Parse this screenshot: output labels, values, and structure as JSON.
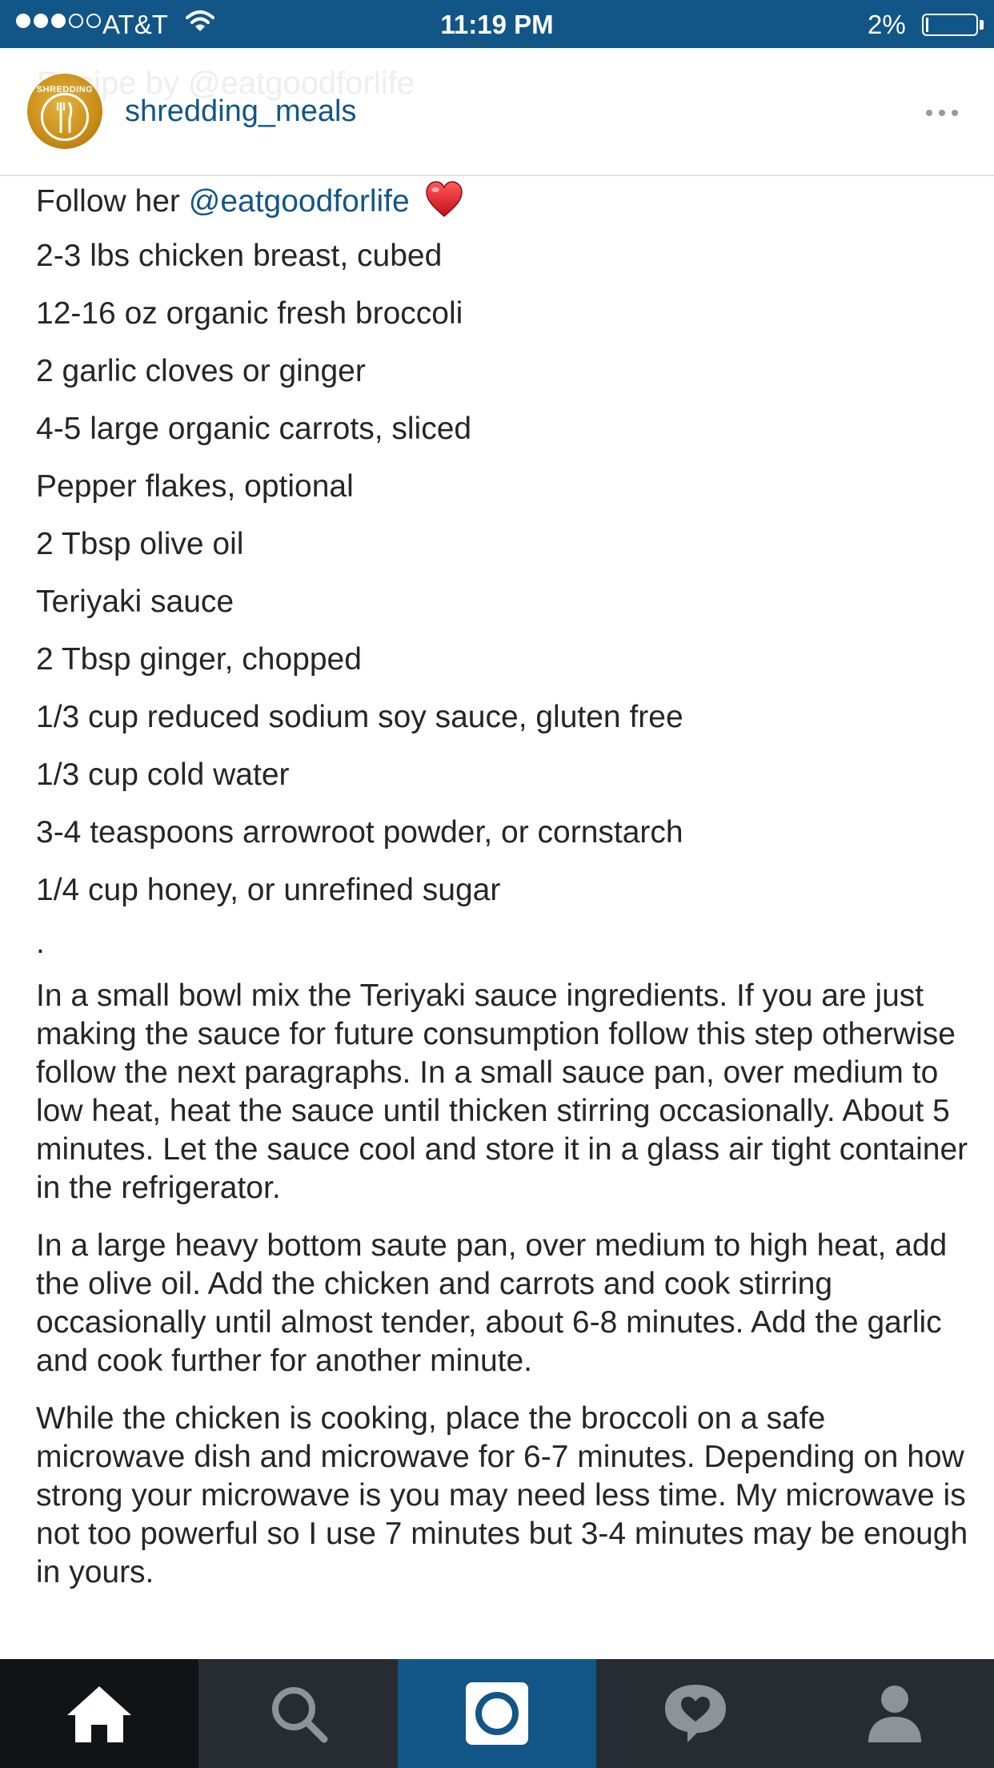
{
  "status_bar": {
    "carrier": "AT&T",
    "time": "11:19 PM",
    "battery_percent": "2%",
    "signal_bars_filled": 3,
    "signal_bars_total": 5,
    "battery_level": 0.02
  },
  "header": {
    "ghost_text": "Recipe by @eatgoodforlife",
    "avatar_text": "SHREDDING",
    "username": "shredding_meals",
    "more_icon": "ellipsis-icon"
  },
  "caption": {
    "follow_prefix": "Follow her ",
    "follow_mention": "@eatgoodforlife",
    "heart_icon": "red-heart-emoji",
    "ingredients": [
      "2-3 lbs chicken breast, cubed",
      "12-16 oz organic fresh broccoli",
      "2 garlic cloves or ginger",
      "4-5 large organic carrots, sliced",
      "Pepper flakes, optional",
      "2 Tbsp olive oil",
      "Teriyaki sauce",
      "2 Tbsp ginger, chopped",
      "1/3 cup reduced sodium soy sauce, gluten free",
      "1/3 cup cold water",
      "3-4 teaspoons arrowroot powder, or cornstarch",
      "1/4 cup honey, or unrefined sugar"
    ],
    "separator": ".",
    "paragraphs": [
      "In a small bowl mix the Teriyaki sauce ingredients. If you are just making the sauce for future consumption follow this step otherwise follow the next paragraphs. In a small sauce pan, over medium to low heat, heat the sauce until thicken stirring occasionally. About 5 minutes. Let the sauce cool and store it in a glass air tight container in the refrigerator.",
      "In a large heavy bottom saute pan, over medium to high heat, add the olive oil. Add the chicken and carrots and cook stirring occasionally until almost tender, about 6-8 minutes. Add the garlic and cook further for another minute.",
      "While the chicken is cooking, place the broccoli on a safe microwave dish and microwave for 6-7 minutes. Depending on how strong your microwave is you may need less time. My microwave is not too powerful so I use 7 minutes but 3-4 minutes may be enough in yours."
    ]
  },
  "tab_bar": {
    "tabs": [
      "home-icon",
      "search-icon",
      "camera-icon",
      "activity-heart-icon",
      "profile-icon"
    ],
    "active": "home-icon"
  },
  "colors": {
    "status_bar_bg": "#125688",
    "link": "#125688",
    "tab_bar_bg": "#262c31",
    "tab_active_bg": "#101417",
    "camera_tab_bg": "#125688"
  }
}
